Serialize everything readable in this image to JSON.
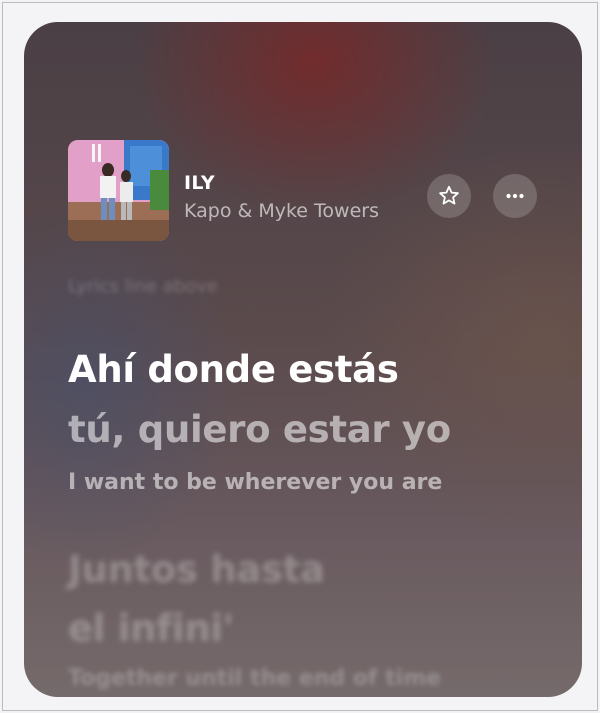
{
  "track": {
    "title": "ILY",
    "artist": "Kapo & Myke Towers"
  },
  "actions": {
    "favorite_icon": "star-icon",
    "more_icon": "ellipsis-icon"
  },
  "lyrics": {
    "previous_line": "Lyrics line above",
    "current_line": "Ahí donde estás",
    "next_line": "tú, quiero estar yo",
    "translation": "I want to be wherever you are",
    "upcoming_line_1": "Juntos hasta",
    "upcoming_line_2": "el infini'",
    "upcoming_translation": "Together until the end of time"
  },
  "colors": {
    "card_top": "#4a3f45",
    "card_accent_red": "#782828",
    "text_primary": "#ffffff"
  }
}
